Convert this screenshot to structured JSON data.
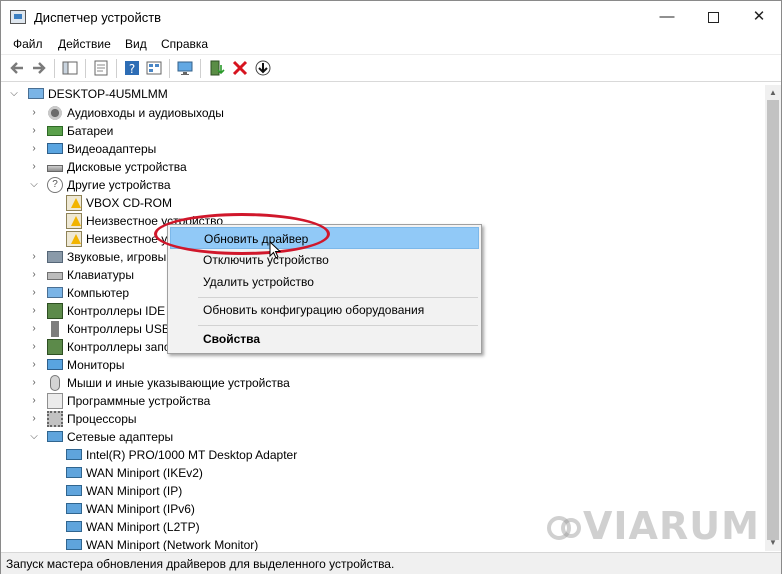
{
  "window": {
    "title": "Диспетчер устройств",
    "minimize_glyph": "—",
    "close_glyph": "✕"
  },
  "menu": {
    "items": [
      "Файл",
      "Действие",
      "Вид",
      "Справка"
    ]
  },
  "toolbar": {
    "icons": [
      "back-icon",
      "forward-icon",
      "show-hide-tree-icon",
      "properties-icon",
      "help-icon",
      "view-icon",
      "display-icon",
      "update-driver-icon",
      "uninstall-icon",
      "download-icon"
    ]
  },
  "tree": {
    "root": "DESKTOP-4U5MLMM",
    "rows": [
      {
        "label": "Аудиовходы и аудиовыходы",
        "icon": "audio-icon"
      },
      {
        "label": "Батареи",
        "icon": "battery-icon"
      },
      {
        "label": "Видеоадаптеры",
        "icon": "display-adapter-icon"
      },
      {
        "label": "Дисковые устройства",
        "icon": "disk-drive-icon"
      },
      {
        "label": "Другие устройства",
        "icon": "other-devices-icon"
      },
      {
        "label": "VBOX CD-ROM",
        "icon": "warning-device-icon"
      },
      {
        "label": "Неизвестное устройство",
        "icon": "warning-device-icon"
      },
      {
        "label": "Неизвестное у",
        "icon": "warning-device-icon"
      },
      {
        "label": "Звуковые, игровы",
        "icon": "sound-icon"
      },
      {
        "label": "Клавиатуры",
        "icon": "keyboard-icon"
      },
      {
        "label": "Компьютер",
        "icon": "computer-icon"
      },
      {
        "label": "Контроллеры IDE",
        "icon": "ide-controller-icon"
      },
      {
        "label": "Контроллеры USB",
        "icon": "usb-controller-icon"
      },
      {
        "label": "Контроллеры запо",
        "icon": "storage-controller-icon"
      },
      {
        "label": "Мониторы",
        "icon": "monitor-icon"
      },
      {
        "label": "Мыши и иные указывающие устройства",
        "icon": "mouse-icon"
      },
      {
        "label": "Программные устройства",
        "icon": "software-device-icon"
      },
      {
        "label": "Процессоры",
        "icon": "processor-icon"
      },
      {
        "label": "Сетевые адаптеры",
        "icon": "network-adapter-icon"
      },
      {
        "label": "Intel(R) PRO/1000 MT Desktop Adapter",
        "icon": "network-adapter-icon"
      },
      {
        "label": "WAN Miniport (IKEv2)",
        "icon": "network-adapter-icon"
      },
      {
        "label": "WAN Miniport (IP)",
        "icon": "network-adapter-icon"
      },
      {
        "label": "WAN Miniport (IPv6)",
        "icon": "network-adapter-icon"
      },
      {
        "label": "WAN Miniport (L2TP)",
        "icon": "network-adapter-icon"
      },
      {
        "label": "WAN Miniport (Network Monitor)",
        "icon": "network-adapter-icon"
      }
    ]
  },
  "context_menu": {
    "update_driver": "Обновить драйвер",
    "disable_device": "Отключить устройство",
    "uninstall_device": "Удалить устройство",
    "scan_hardware": "Обновить конфигурацию оборудования",
    "properties": "Свойства"
  },
  "status": {
    "text": "Запуск мастера обновления драйверов для выделенного устройства."
  },
  "watermark": {
    "text": "VIARUM"
  },
  "colors": {
    "highlight": "#91c9f7",
    "annotation_red": "#d0172b",
    "uninstall_red": "#d7141f"
  }
}
